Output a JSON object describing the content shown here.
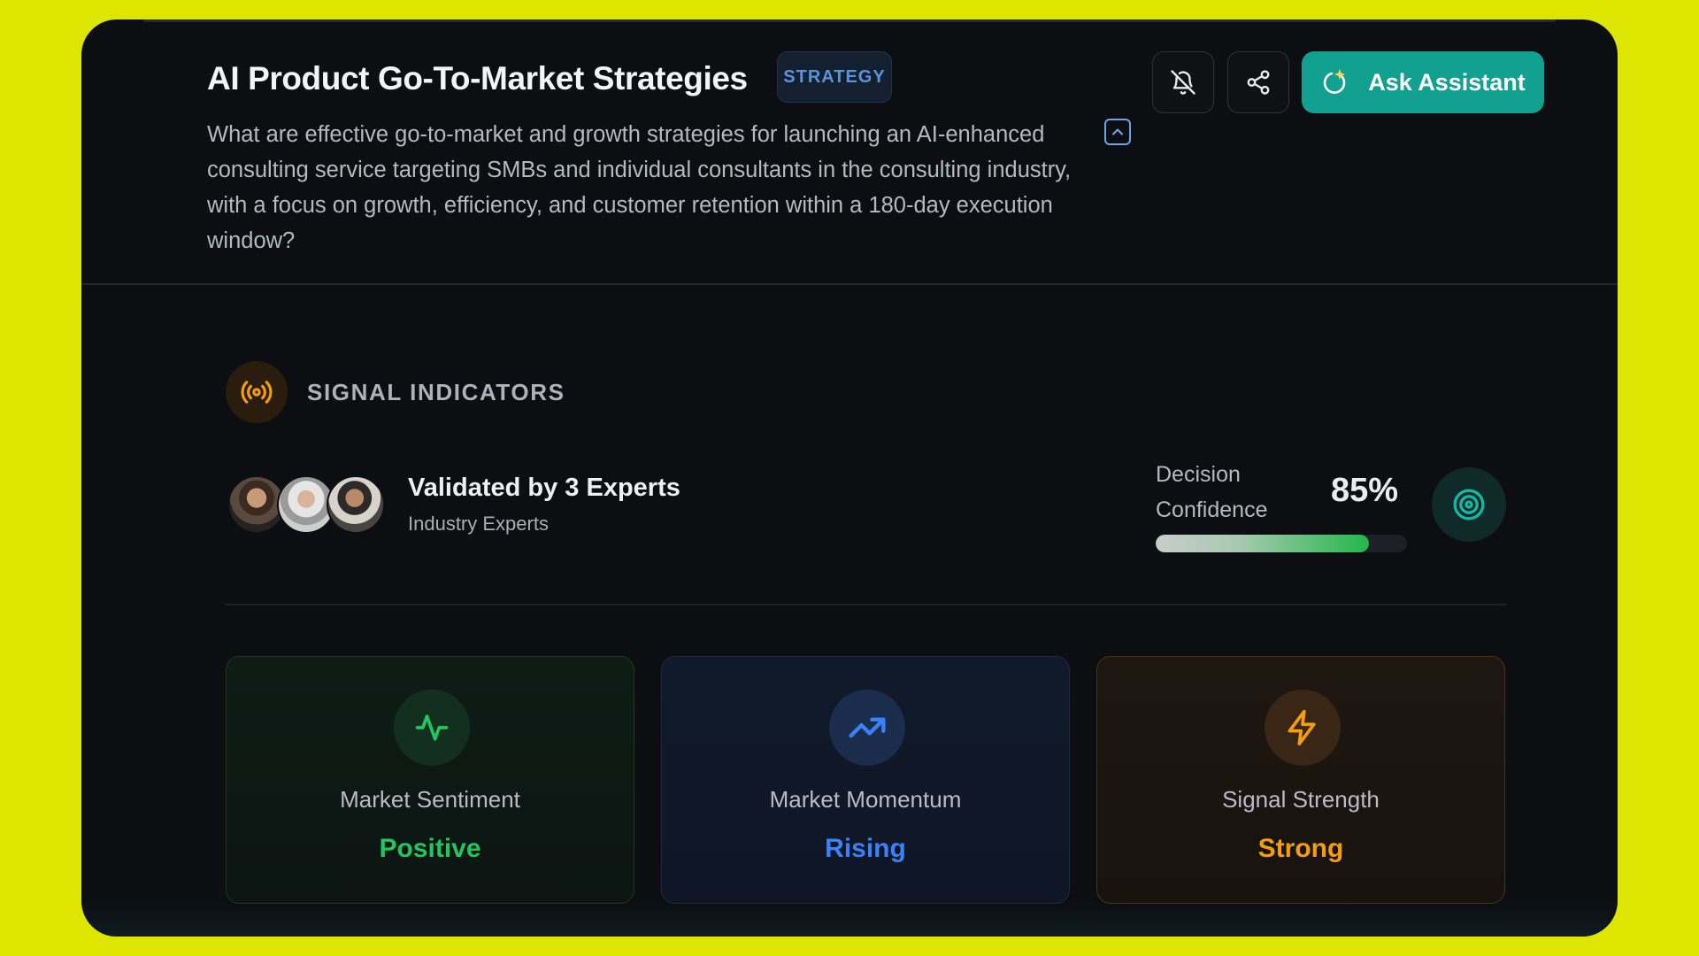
{
  "header": {
    "title": "AI Product Go-To-Market Strategies",
    "tag": "STRATEGY",
    "description": "What are effective go-to-market and growth strategies for launching an AI-enhanced consulting service targeting SMBs and individual consultants in the consulting industry, with a focus on growth, efficiency, and customer retention within a 180-day execution window?",
    "actions": {
      "mute_icon": "bell-off-icon",
      "share_icon": "share-icon",
      "ask_label": "Ask Assistant",
      "ask_icon": "sparkle-refresh-icon",
      "collapse_icon": "chevron-up-icon"
    }
  },
  "signals": {
    "section_title": "SIGNAL INDICATORS",
    "section_icon": "broadcast-icon",
    "validation": {
      "title": "Validated by 3 Experts",
      "subtitle": "Industry Experts",
      "avatar_count": 3
    },
    "confidence": {
      "label": "Decision Confidence",
      "value_text": "85%",
      "value": 0.85,
      "icon": "target-icon"
    },
    "metrics": [
      {
        "label": "Market Sentiment",
        "value": "Positive",
        "icon": "activity-icon",
        "color": "#22c55e"
      },
      {
        "label": "Market Momentum",
        "value": "Rising",
        "icon": "trending-up-icon",
        "color": "#3b82f6"
      },
      {
        "label": "Signal Strength",
        "value": "Strong",
        "icon": "lightning-icon",
        "color": "#f59e0b"
      }
    ]
  },
  "colors": {
    "background": "#dde600",
    "panel": "#0c0e12",
    "accent": "#12a090",
    "tag_text": "#5b93d8",
    "broadcast": "#f59e0b"
  }
}
